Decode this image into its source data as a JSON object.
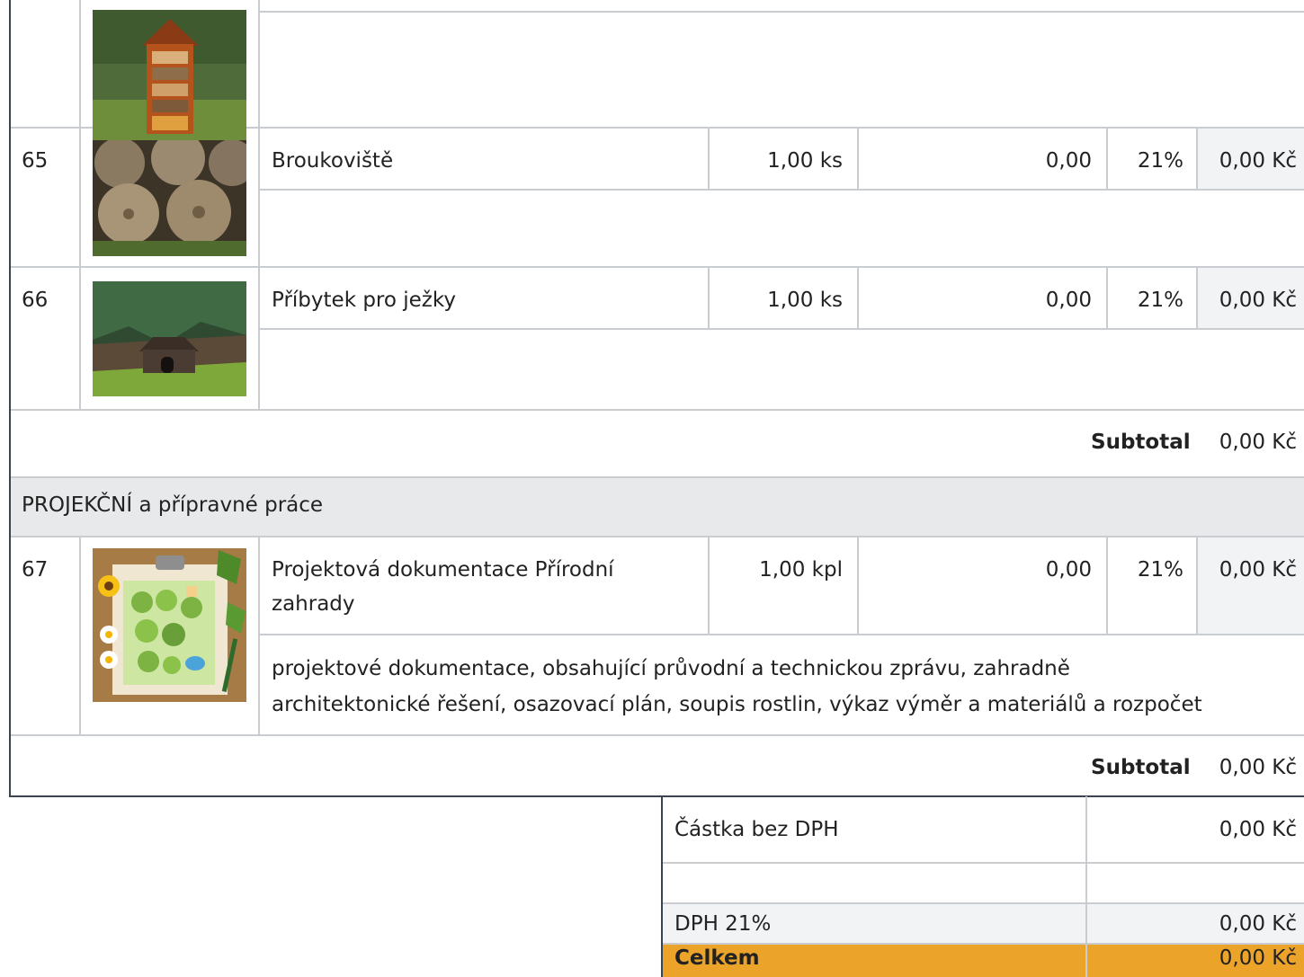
{
  "items": [
    {
      "number": "65",
      "name": "Broukoviště",
      "qty": "1,00 ks",
      "price": "0,00",
      "vat": "21%",
      "total": "0,00 Kč",
      "image_icon": "log-pile-icon"
    },
    {
      "number": "66",
      "name": "Příbytek pro ježky",
      "qty": "1,00 ks",
      "price": "0,00",
      "vat": "21%",
      "total": "0,00 Kč",
      "image_icon": "hedgehog-house-icon"
    },
    {
      "number": "67",
      "name_line1": "Projektová dokumentace Přírodní",
      "name_line2": "zahrady",
      "qty": "1,00 kpl",
      "price": "0,00",
      "vat": "21%",
      "total": "0,00 Kč",
      "image_icon": "garden-plan-icon",
      "description_line1": "projektové dokumentace, obsahující průvodní a technickou zprávu, zahradně",
      "description_line2": "architektonické řešení, osazovací plán, soupis rostlin, výkaz výměr a materiálů a rozpočet"
    }
  ],
  "top_image_icon": "insect-hotel-icon",
  "subtotal_1": {
    "label": "Subtotal",
    "value": "0,00 Kč"
  },
  "section_title": "PROJEKČNÍ a přípravné práce",
  "subtotal_2": {
    "label": "Subtotal",
    "value": "0,00 Kč"
  },
  "summary": {
    "net_label": "Částka bez DPH",
    "net_value": "0,00 Kč",
    "vat_label": "DPH 21%",
    "vat_value": "0,00 Kč",
    "total_label": "Celkem",
    "total_value": "0,00 Kč"
  },
  "colors": {
    "accent": "#eba32a",
    "row_shade": "#f2f3f5",
    "section_bg": "#e8e9eb",
    "border": "#c9cdd2"
  }
}
